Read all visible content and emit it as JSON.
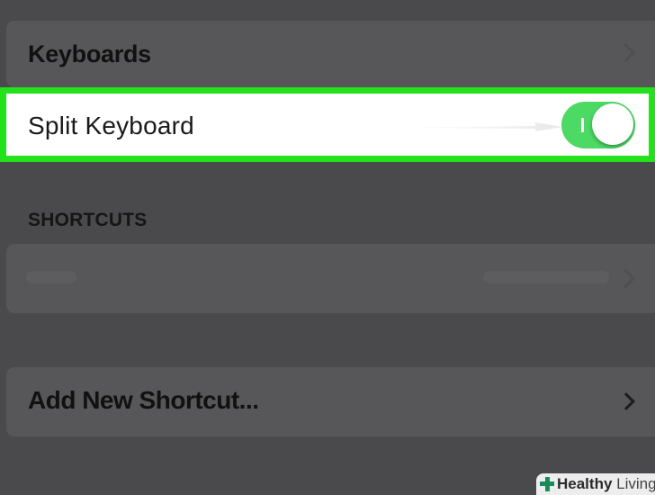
{
  "keyboards_row": {
    "label": "Keyboards"
  },
  "split_keyboard_row": {
    "label": "Split Keyboard",
    "toggle_on": true,
    "toggle_on_mark": "I",
    "toggle_color": "#4cd964",
    "highlight_color": "#23e21b"
  },
  "shortcuts_section": {
    "header": "SHORTCUTS"
  },
  "add_shortcut_row": {
    "label": "Add New Shortcut...",
    "chevron": "chevron-right-icon"
  },
  "watermark": {
    "brand_bold": "Healthy",
    "brand_light": "Living",
    "icon": "plus-cross-icon"
  }
}
